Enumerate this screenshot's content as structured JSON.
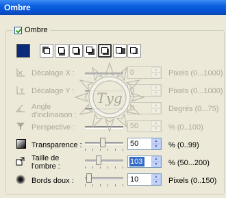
{
  "window": {
    "title": "Ombre"
  },
  "group": {
    "checkbox_label": "Ombre",
    "checked": true
  },
  "shadow_color": "#0b2a7a",
  "positions": [
    {
      "name": "pos-top-left"
    },
    {
      "name": "pos-top"
    },
    {
      "name": "pos-top-right"
    },
    {
      "name": "pos-bottom-left"
    },
    {
      "name": "pos-center",
      "active": true
    },
    {
      "name": "pos-bottom-right"
    },
    {
      "name": "pos-right"
    }
  ],
  "rows": {
    "offset_x": {
      "label": "Décalage X :",
      "value": "0",
      "unit": "Pixels (0...1000)",
      "enabled": false
    },
    "offset_y": {
      "label": "Décalage Y :",
      "value": "0",
      "unit": "Pixels (0...1000)",
      "enabled": false
    },
    "angle": {
      "label_line1": "Angle",
      "label_line2": "d'inclinaison :",
      "value": "0",
      "unit": "Degrés (0...75)",
      "enabled": false
    },
    "perspective": {
      "label": "Perspective :",
      "value": "50",
      "unit": "% (0..100)",
      "enabled": false
    },
    "transparency": {
      "label": "Transparence :",
      "value": "50",
      "unit": "% (0..99)",
      "enabled": true,
      "level": 0.5
    },
    "shadow_size": {
      "label_line1": "Taille de",
      "label_line2": "l'ombre :",
      "value": "103",
      "unit": "% (50...200)",
      "enabled": true,
      "level": 0.35
    },
    "soft_edges": {
      "label": "Bords doux :",
      "value": "10",
      "unit": "Pixels (0..150)",
      "enabled": true,
      "level": 0.07
    }
  },
  "watermark": {
    "text": "Tyg"
  }
}
